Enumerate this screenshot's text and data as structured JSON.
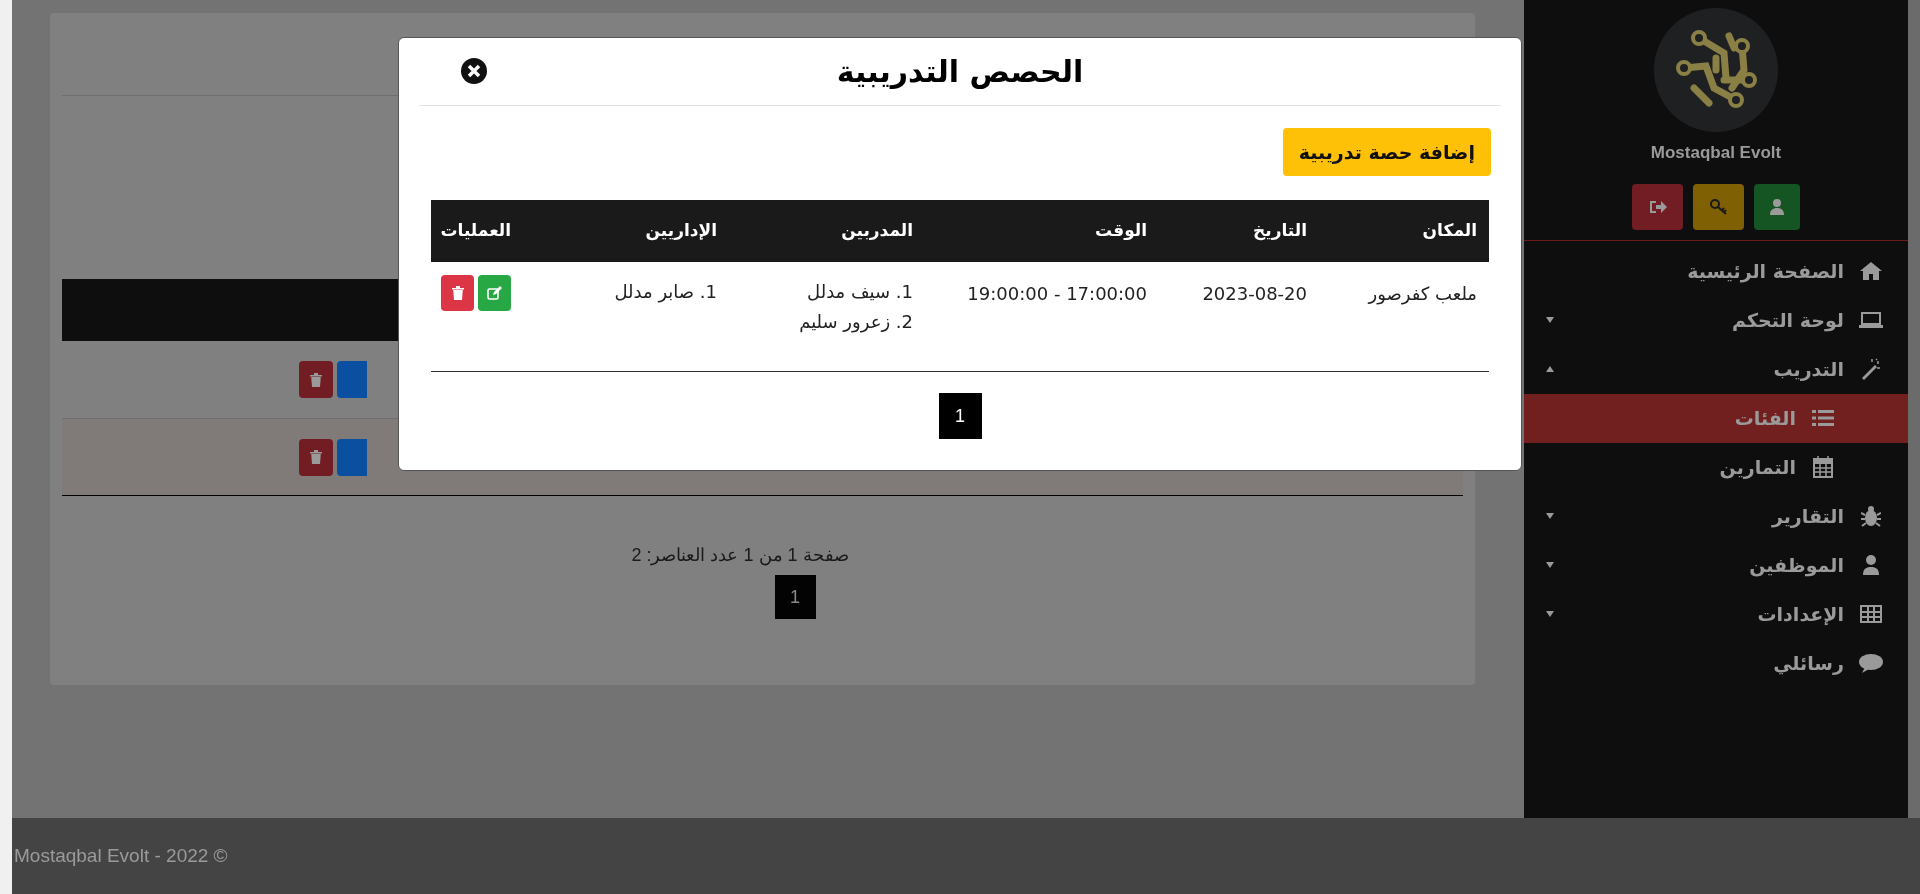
{
  "background_pagination": {
    "summary": "صفحة 1 من 1 عدد العناصر: 2",
    "pages": [
      {
        "label": "1",
        "selected": true
      }
    ]
  },
  "sidebar": {
    "brand": "Mostaqbal Evolt",
    "menu": [
      {
        "label": "الصفحة الرئيسية",
        "selected": false
      },
      {
        "label": "لوحة التحكم",
        "selected": false,
        "expanded": false
      },
      {
        "label": "التدريب",
        "selected": false,
        "expanded": true,
        "children": [
          {
            "label": "الفئات",
            "selected": true
          },
          {
            "label": "التمارين",
            "selected": false
          }
        ]
      },
      {
        "label": "التقارير",
        "selected": false,
        "expanded": false
      },
      {
        "label": "الموظفين",
        "selected": false,
        "expanded": false
      },
      {
        "label": "الإعدادات",
        "selected": false,
        "expanded": false
      },
      {
        "label": "رسائلي",
        "selected": false
      }
    ]
  },
  "modal": {
    "title": "الحصص التدريبية",
    "add_button": "إضافة حصة تدريبية",
    "columns": [
      "المكان",
      "التاريخ",
      "الوقت",
      "المدربين",
      "الإداريين",
      "العمليات"
    ],
    "rows": [
      {
        "place": "ملعب كفرصور",
        "date": "2023-08-20",
        "time": "17:00:00 - 19:00:00",
        "trainers": [
          "1. سيف مدلل",
          "2. زعرور سليم"
        ],
        "admins": [
          "1. صابر مدلل"
        ]
      }
    ],
    "pages": [
      {
        "label": "1",
        "selected": true
      }
    ]
  },
  "footer": {
    "text": "Mostaqbal Evolt - 2022 ©"
  }
}
